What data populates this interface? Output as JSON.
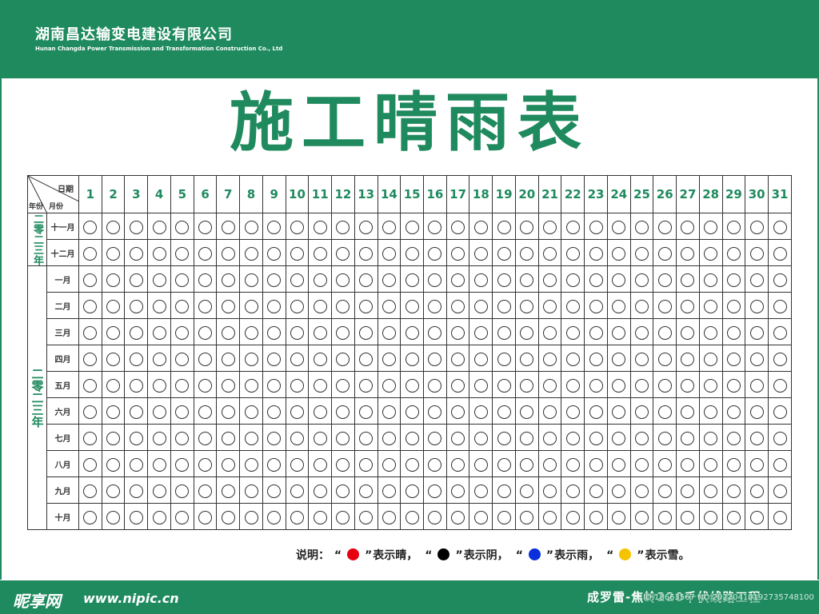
{
  "header": {
    "company_name": "湖南昌达输变电建设有限公司",
    "company_name_en": "Hunan Changda Power Transmission and Transformation Construction Co., Ltd"
  },
  "title": "施工晴雨表",
  "table": {
    "corner_date": "日期",
    "corner_year": "年份",
    "corner_month": "月份",
    "days": [
      "1",
      "2",
      "3",
      "4",
      "5",
      "6",
      "7",
      "8",
      "9",
      "10",
      "11",
      "12",
      "13",
      "14",
      "15",
      "16",
      "17",
      "18",
      "19",
      "20",
      "21",
      "22",
      "23",
      "24",
      "25",
      "26",
      "27",
      "28",
      "29",
      "30",
      "31"
    ],
    "year_groups": [
      {
        "label": "二零二三年",
        "months": [
          "十一月",
          "十二月"
        ]
      },
      {
        "label": "二零二三年",
        "months": [
          "一月",
          "二月",
          "三月",
          "四月",
          "五月",
          "六月",
          "七月",
          "八月",
          "九月",
          "十月"
        ]
      }
    ]
  },
  "legend": {
    "prefix": "说明：",
    "items": [
      {
        "color": "#e60012",
        "label": "表示晴，"
      },
      {
        "color": "#000000",
        "label": "表示阴，"
      },
      {
        "color": "#0a2fdc",
        "label": "表示雨，"
      },
      {
        "color": "#f6c300",
        "label": "表示雪。"
      }
    ]
  },
  "footer": {
    "logo": "昵享网",
    "url": "www.nipic.cn",
    "project_name": "成罗雷-焦岭220千伏线路工程",
    "image_id": "ID:18663567 NO:20220410192735748100"
  }
}
